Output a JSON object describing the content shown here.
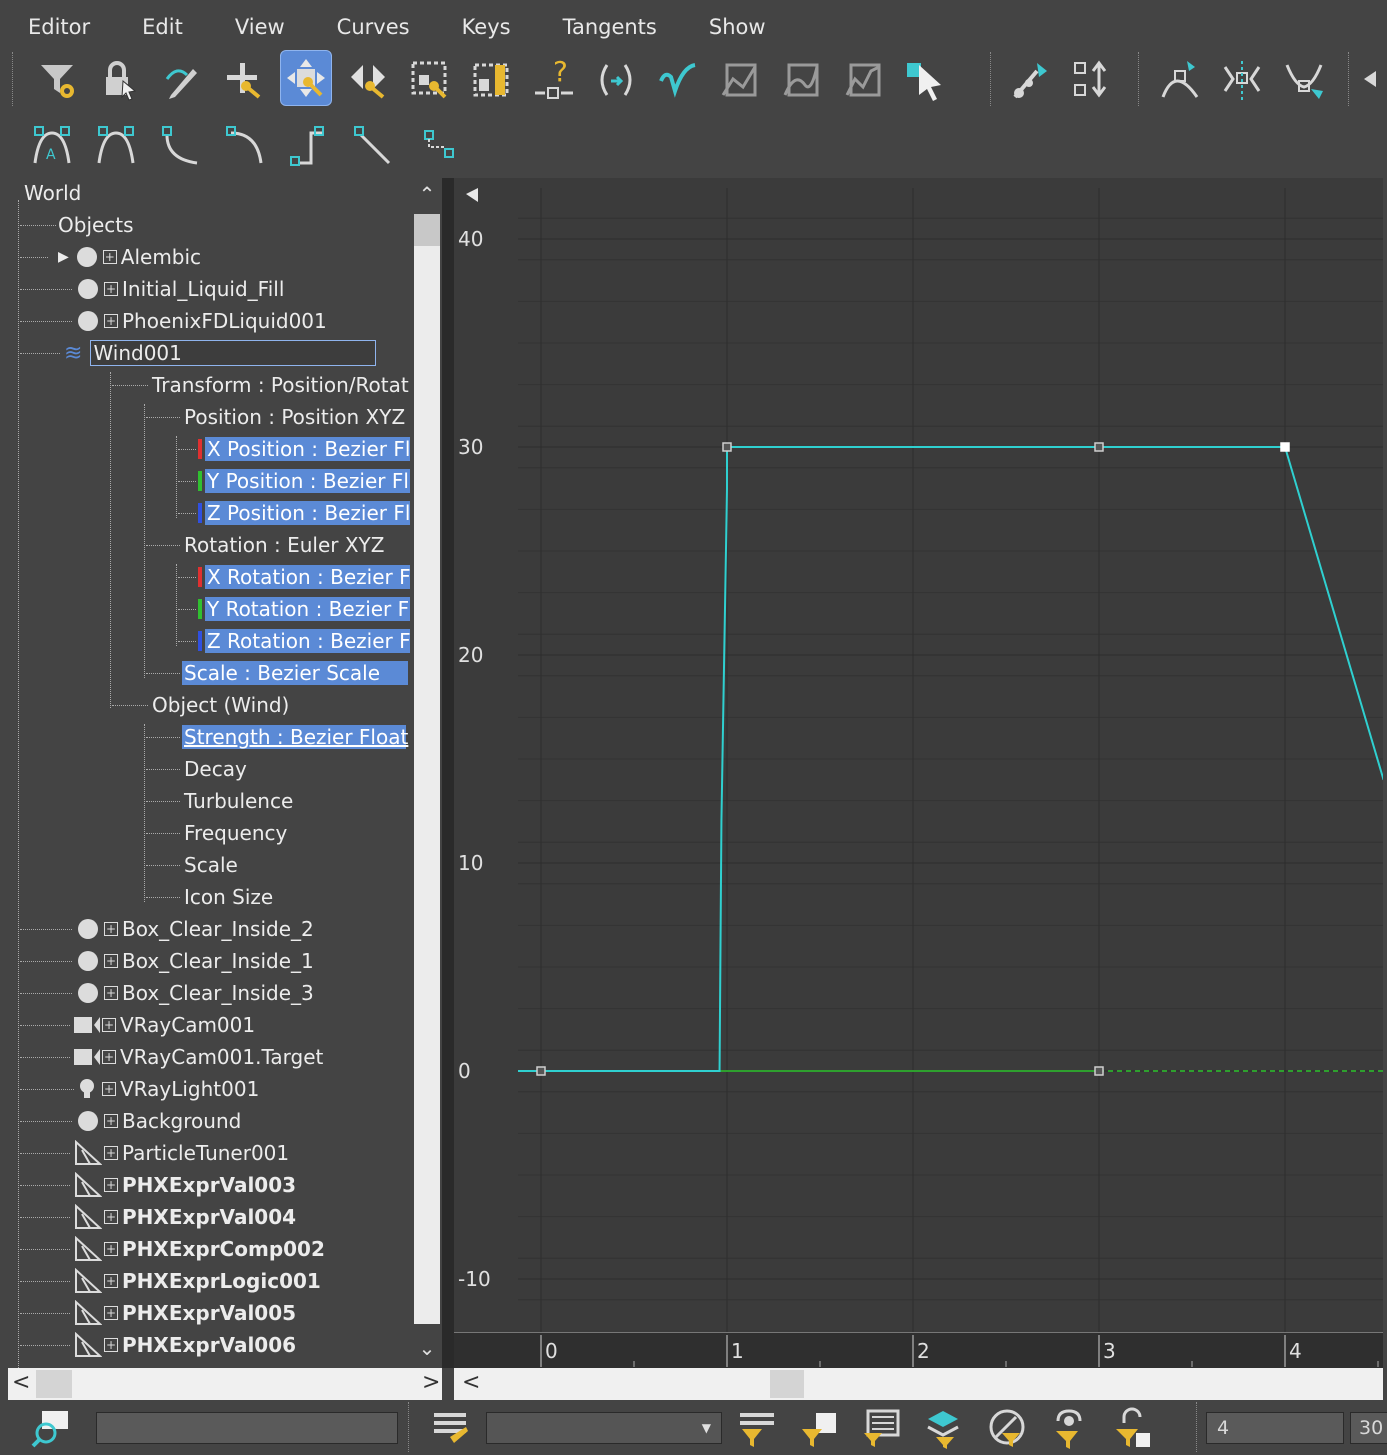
{
  "menubar": {
    "items": [
      "Editor",
      "Edit",
      "View",
      "Curves",
      "Keys",
      "Tangents",
      "Show"
    ]
  },
  "toolbar1": {
    "icons": [
      "filter-icon",
      "lock-selection-icon",
      "draw-curves-icon",
      "add-keys-icon",
      "move-keys-icon",
      "slide-keys-icon",
      "scale-keys-icon",
      "scale-values-icon",
      "isolate-curve-icon",
      "parameter-out-of-range-icon",
      "reduce-keys-icon",
      "tangent-auto-icon",
      "tangent-spline-icon",
      "tangent-fast-icon",
      "tangent-slow-icon",
      "select-keys-icon",
      "snap-frames-icon",
      "show-keyable-icon",
      "show-all-tangents-icon",
      "show-tangents-icon",
      "lock-tangents-icon",
      "more-icon"
    ]
  },
  "toolbar2": {
    "icons": [
      "tangent-auto-flyout-icon",
      "tangent-custom-flyout-icon",
      "tangent-fast-flyout-icon",
      "tangent-slow-flyout-icon",
      "tangent-step-flyout-icon",
      "tangent-linear-flyout-icon",
      "tangent-smooth-flyout-icon"
    ]
  },
  "tree": {
    "root": "World",
    "objects_label": "Objects",
    "rows": [
      {
        "label": "Alembic",
        "icon": "sphere",
        "expand": true
      },
      {
        "label": "Initial_Liquid_Fill",
        "icon": "sphere"
      },
      {
        "label": "PhoenixFDLiquid001",
        "icon": "sphere"
      },
      {
        "label": "Wind001",
        "icon": "wind"
      },
      {
        "label": "Transform : Position/Rotat"
      },
      {
        "label": "Position : Position XYZ"
      },
      {
        "label": "X Position : Bezier Flo",
        "axis": "#e03030"
      },
      {
        "label": "Y Position : Bezier Flo",
        "axis": "#30c030"
      },
      {
        "label": "Z Position : Bezier Flo",
        "axis": "#3050e0"
      },
      {
        "label": "Rotation : Euler XYZ"
      },
      {
        "label": "X Rotation : Bezier Fl",
        "axis": "#e03030"
      },
      {
        "label": "Y Rotation : Bezier Fl",
        "axis": "#30c030"
      },
      {
        "label": "Z Rotation : Bezier Fl",
        "axis": "#3050e0"
      },
      {
        "label": "Scale : Bezier Scale"
      },
      {
        "label": "Object (Wind)"
      },
      {
        "label": "Strength : Bezier Float"
      },
      {
        "label": "Decay"
      },
      {
        "label": "Turbulence"
      },
      {
        "label": "Frequency"
      },
      {
        "label": "Scale"
      },
      {
        "label": "Icon Size"
      },
      {
        "label": "Box_Clear_Inside_2",
        "icon": "sphere"
      },
      {
        "label": "Box_Clear_Inside_1",
        "icon": "sphere"
      },
      {
        "label": "Box_Clear_Inside_3",
        "icon": "sphere"
      },
      {
        "label": "VRayCam001",
        "icon": "camera"
      },
      {
        "label": "VRayCam001.Target",
        "icon": "camera"
      },
      {
        "label": "VRayLight001",
        "icon": "light"
      },
      {
        "label": "Background",
        "icon": "sphere"
      },
      {
        "label": "ParticleTuner001",
        "icon": "tuner"
      },
      {
        "label": "PHXExprVal003",
        "icon": "tuner",
        "bold": true
      },
      {
        "label": "PHXExprVal004",
        "icon": "tuner",
        "bold": true
      },
      {
        "label": "PHXExprComp002",
        "icon": "tuner",
        "bold": true
      },
      {
        "label": "PHXExprLogic001",
        "icon": "tuner",
        "bold": true
      },
      {
        "label": "PHXExprVal005",
        "icon": "tuner",
        "bold": true
      },
      {
        "label": "PHXExprVal006",
        "icon": "tuner",
        "bold": true
      }
    ]
  },
  "graph": {
    "y_ticks": [
      "40",
      "30",
      "20",
      "10",
      "0",
      "-10"
    ],
    "x_ticks": [
      "0",
      "1",
      "2",
      "3",
      "4"
    ],
    "curve_color": "#2fd0d0",
    "baseline_color": "#2ea02e",
    "keys": [
      {
        "frame": 0,
        "value": 0
      },
      {
        "frame": 1,
        "value": 30
      },
      {
        "frame": 3,
        "value": 30
      },
      {
        "frame": 4,
        "value": 30
      },
      {
        "frame": 3,
        "value": 0
      }
    ]
  },
  "bottombar": {
    "search_placeholder": "",
    "frame_value": "4",
    "value_field": "30",
    "icons": [
      "zoom-search-icon",
      "track-view-filter-icon",
      "curve-filter-icon",
      "select-by-filter-icon",
      "frame-filter-icon",
      "layer-filter-icon",
      "visibility-filter-icon",
      "lock-key-icon",
      "lock-tangent-icon"
    ]
  },
  "colors": {
    "panel_bg": "#444444",
    "graph_bg": "#3b3b3b",
    "highlight": "#5b8ad6",
    "curve": "#2fd0d0"
  }
}
